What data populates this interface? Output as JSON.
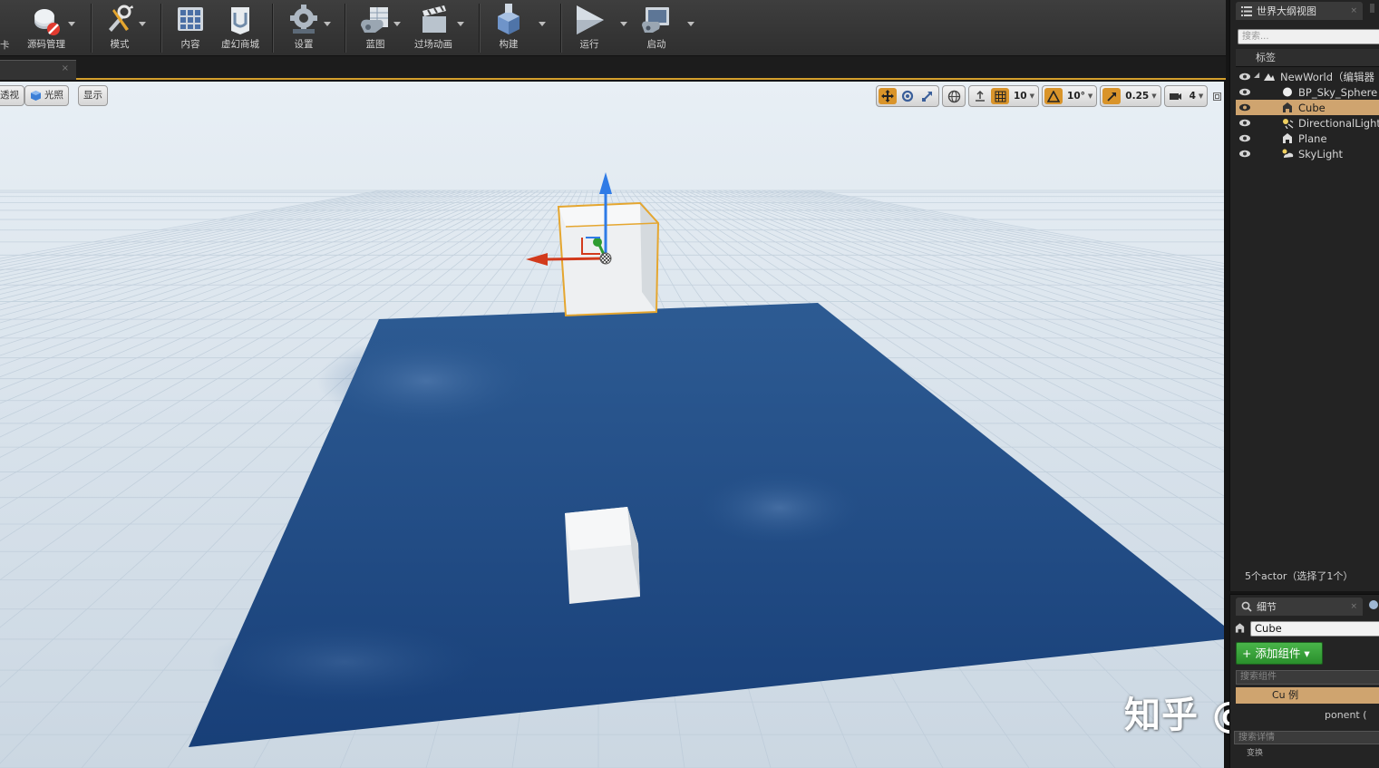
{
  "toolbar": {
    "partial_left_label": "卡",
    "items": [
      {
        "label": "源码管理",
        "icon": "source-control-icon"
      },
      {
        "label": "模式",
        "icon": "modes-icon"
      },
      {
        "label": "内容",
        "icon": "content-icon"
      },
      {
        "label": "虚幻商城",
        "icon": "marketplace-icon"
      },
      {
        "label": "设置",
        "icon": "settings-gear-icon"
      },
      {
        "label": "蓝图",
        "icon": "blueprint-icon"
      },
      {
        "label": "过场动画",
        "icon": "clapperboard-icon"
      },
      {
        "label": "构建",
        "icon": "build-icon"
      },
      {
        "label": "运行",
        "icon": "play-icon"
      },
      {
        "label": "启动",
        "icon": "launch-icon"
      }
    ]
  },
  "viewport": {
    "left_buttons": [
      {
        "label": "透视",
        "icon": ""
      },
      {
        "label": "光照",
        "icon": "lit-cube-icon"
      },
      {
        "label": "显示",
        "icon": ""
      }
    ],
    "grid_snap": "10",
    "rotation_snap": "10°",
    "scale_snap": "0.25",
    "camera_speed": "4",
    "colors": {
      "sky": "#d9e3ec",
      "plane": "#1f4a86",
      "selection": "#e5a62f",
      "axis_z": "#2f7be6",
      "axis_y": "#d23a1c",
      "axis_x": "#2d9c31"
    }
  },
  "watermark": "知乎 @珊哥",
  "outliner": {
    "tab_label": "世界大纲视图",
    "search_placeholder": "搜索...",
    "column_header": "标签",
    "rows": [
      {
        "label": "NewWorld（编辑器",
        "icon": "world-icon",
        "selected": false
      },
      {
        "label": "BP_Sky_Sphere",
        "icon": "sphere-icon",
        "selected": false
      },
      {
        "label": "Cube",
        "icon": "static-mesh-icon",
        "selected": true
      },
      {
        "label": "DirectionalLight",
        "icon": "directional-light-icon",
        "selected": false
      },
      {
        "label": "Plane",
        "icon": "static-mesh-icon",
        "selected": false
      },
      {
        "label": "SkyLight",
        "icon": "sky-light-icon",
        "selected": false
      }
    ],
    "actor_count": "5个actor（选择了1个）"
  },
  "details": {
    "tab_label": "细节",
    "actor_name": "Cube",
    "add_component_label": "+ 添加组件 ▾",
    "component_search_placeholder": "搜索组件",
    "component_row_partial": "Cu        例",
    "component_row_2_partial": "ponent (",
    "details_search_placeholder": "搜索详情",
    "category_partial": "变换"
  }
}
